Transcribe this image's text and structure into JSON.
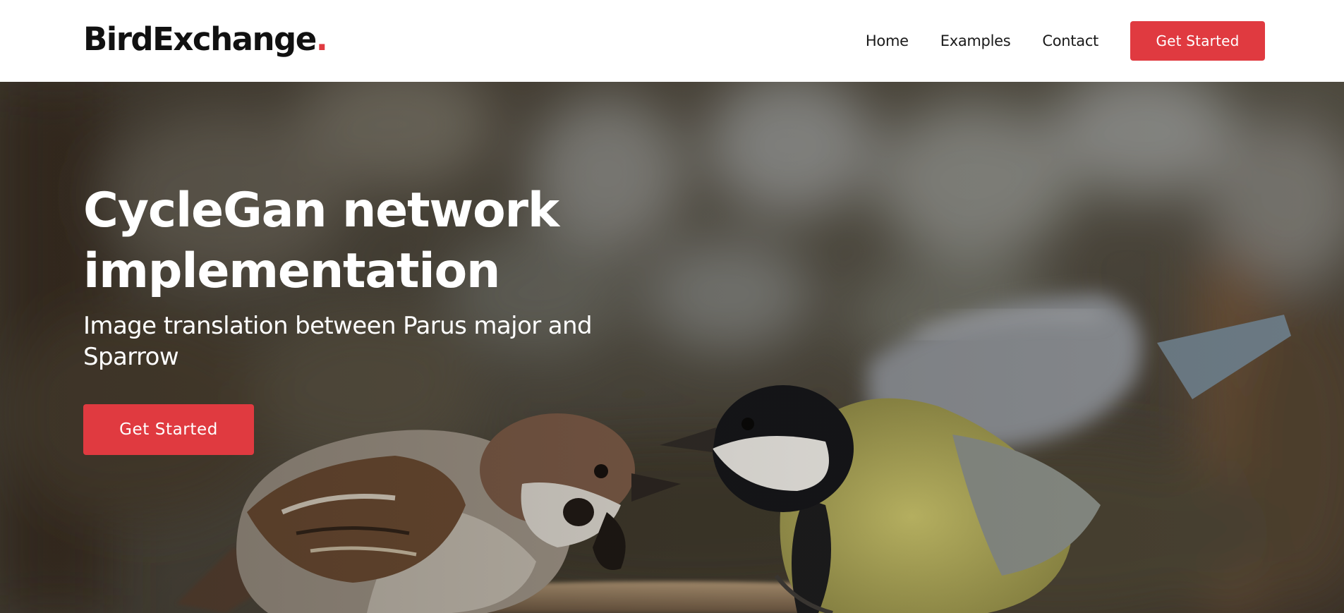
{
  "header": {
    "brand": "BirdExchange",
    "brand_dot": ".",
    "nav": [
      {
        "label": "Home"
      },
      {
        "label": "Examples"
      },
      {
        "label": "Contact"
      }
    ],
    "cta_label": "Get Started"
  },
  "hero": {
    "title": "CycleGan network implementation",
    "subtitle": "Image translation between Parus major and Sparrow",
    "cta_label": "Get Started",
    "image_subject": "sparrow and great tit (Parus major) feeding each other"
  },
  "colors": {
    "accent": "#e03a40",
    "header_bg": "#ffffff",
    "text_dark": "#111111",
    "hero_text": "#ffffff"
  }
}
